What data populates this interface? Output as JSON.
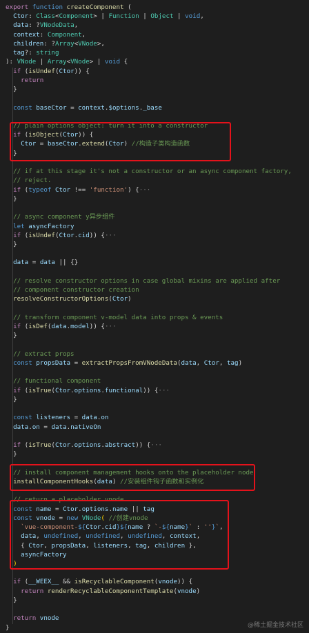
{
  "editor": {
    "title": "createComponent",
    "lines": [
      [
        [
          "c",
          "export "
        ],
        [
          "k",
          "function "
        ],
        [
          "f",
          "createComponent"
        ],
        [
          "n",
          " ("
        ]
      ],
      [
        [
          "v",
          "  Ctor"
        ],
        [
          "n",
          ": "
        ],
        [
          "ty",
          "Class"
        ],
        [
          "n",
          "<"
        ],
        [
          "ty",
          "Component"
        ],
        [
          "n",
          "> | "
        ],
        [
          "ty",
          "Function"
        ],
        [
          "n",
          " | "
        ],
        [
          "ty",
          "Object"
        ],
        [
          "n",
          " | "
        ],
        [
          "k",
          "void"
        ],
        [
          "n",
          ","
        ]
      ],
      [
        [
          "v",
          "  data"
        ],
        [
          "n",
          ": ?"
        ],
        [
          "ty",
          "VNodeData"
        ],
        [
          "n",
          ","
        ]
      ],
      [
        [
          "v",
          "  context"
        ],
        [
          "n",
          ": "
        ],
        [
          "ty",
          "Component"
        ],
        [
          "n",
          ","
        ]
      ],
      [
        [
          "v",
          "  children"
        ],
        [
          "n",
          ": ?"
        ],
        [
          "ty",
          "Array"
        ],
        [
          "n",
          "<"
        ],
        [
          "ty",
          "VNode"
        ],
        [
          "n",
          ">,"
        ]
      ],
      [
        [
          "v",
          "  tag"
        ],
        [
          "n",
          "?: "
        ],
        [
          "ty",
          "string"
        ]
      ],
      [
        [
          "n",
          "): "
        ],
        [
          "ty",
          "VNode"
        ],
        [
          "n",
          " | "
        ],
        [
          "ty",
          "Array"
        ],
        [
          "n",
          "<"
        ],
        [
          "ty",
          "VNode"
        ],
        [
          "n",
          "> | "
        ],
        [
          "k",
          "void"
        ],
        [
          "n",
          " {"
        ]
      ],
      [
        [
          "c",
          "  if "
        ],
        [
          "n",
          "("
        ],
        [
          "f",
          "isUndef"
        ],
        [
          "n",
          "("
        ],
        [
          "v",
          "Ctor"
        ],
        [
          "n",
          ")) {"
        ]
      ],
      [
        [
          "c",
          "    return"
        ]
      ],
      [
        [
          "n",
          "  }"
        ]
      ],
      [
        [
          "n",
          ""
        ]
      ],
      [
        [
          "k",
          "  const "
        ],
        [
          "v",
          "baseCtor"
        ],
        [
          "n",
          " = "
        ],
        [
          "v",
          "context"
        ],
        [
          "n",
          "."
        ],
        [
          "v",
          "$options"
        ],
        [
          "n",
          "."
        ],
        [
          "v",
          "_base"
        ]
      ],
      [
        [
          "n",
          ""
        ]
      ],
      [
        [
          "cm",
          "  // plain options object: turn it into a constructor"
        ]
      ],
      [
        [
          "c",
          "  if "
        ],
        [
          "n",
          "("
        ],
        [
          "f",
          "isObject"
        ],
        [
          "n",
          "("
        ],
        [
          "v",
          "Ctor"
        ],
        [
          "n",
          ")) {"
        ]
      ],
      [
        [
          "v",
          "    Ctor"
        ],
        [
          "n",
          " = "
        ],
        [
          "v",
          "baseCtor"
        ],
        [
          "n",
          "."
        ],
        [
          "f",
          "extend"
        ],
        [
          "n",
          "("
        ],
        [
          "v",
          "Ctor"
        ],
        [
          "n",
          ") "
        ],
        [
          "cm",
          "//构造子类构造函数"
        ]
      ],
      [
        [
          "n",
          "  }"
        ]
      ],
      [
        [
          "n",
          ""
        ]
      ],
      [
        [
          "cm",
          "  // if at this stage it's not a constructor or an async component factory,"
        ]
      ],
      [
        [
          "cm",
          "  // reject."
        ]
      ],
      [
        [
          "c",
          "  if "
        ],
        [
          "n",
          "("
        ],
        [
          "k",
          "typeof "
        ],
        [
          "v",
          "Ctor"
        ],
        [
          "n",
          " !== "
        ],
        [
          "s",
          "'function'"
        ],
        [
          "n",
          ") {"
        ],
        [
          "fold",
          "···"
        ]
      ],
      [
        [
          "n",
          "  }"
        ]
      ],
      [
        [
          "n",
          ""
        ]
      ],
      [
        [
          "cm",
          "  // async component y异步组件"
        ]
      ],
      [
        [
          "k",
          "  let "
        ],
        [
          "v",
          "asyncFactory"
        ]
      ],
      [
        [
          "c",
          "  if "
        ],
        [
          "n",
          "("
        ],
        [
          "f",
          "isUndef"
        ],
        [
          "n",
          "("
        ],
        [
          "v",
          "Ctor"
        ],
        [
          "n",
          "."
        ],
        [
          "v",
          "cid"
        ],
        [
          "n",
          ")) {"
        ],
        [
          "fold",
          "···"
        ]
      ],
      [
        [
          "n",
          "  }"
        ]
      ],
      [
        [
          "n",
          ""
        ]
      ],
      [
        [
          "v",
          "  data"
        ],
        [
          "n",
          " = "
        ],
        [
          "v",
          "data"
        ],
        [
          "n",
          " || {}"
        ]
      ],
      [
        [
          "n",
          ""
        ]
      ],
      [
        [
          "cm",
          "  // resolve constructor options in case global mixins are applied after"
        ]
      ],
      [
        [
          "cm",
          "  // component constructor creation"
        ]
      ],
      [
        [
          "f",
          "  resolveConstructorOptions"
        ],
        [
          "n",
          "("
        ],
        [
          "v",
          "Ctor"
        ],
        [
          "n",
          ")"
        ]
      ],
      [
        [
          "n",
          ""
        ]
      ],
      [
        [
          "cm",
          "  // transform component v-model data into props & events"
        ]
      ],
      [
        [
          "c",
          "  if "
        ],
        [
          "n",
          "("
        ],
        [
          "f",
          "isDef"
        ],
        [
          "n",
          "("
        ],
        [
          "v",
          "data"
        ],
        [
          "n",
          "."
        ],
        [
          "v",
          "model"
        ],
        [
          "n",
          ")) {"
        ],
        [
          "fold",
          "···"
        ]
      ],
      [
        [
          "n",
          "  }"
        ]
      ],
      [
        [
          "n",
          ""
        ]
      ],
      [
        [
          "cm",
          "  // extract props"
        ]
      ],
      [
        [
          "k",
          "  const "
        ],
        [
          "v",
          "propsData"
        ],
        [
          "n",
          " = "
        ],
        [
          "f",
          "extractPropsFromVNodeData"
        ],
        [
          "n",
          "("
        ],
        [
          "v",
          "data"
        ],
        [
          "n",
          ", "
        ],
        [
          "v",
          "Ctor"
        ],
        [
          "n",
          ", "
        ],
        [
          "v",
          "tag"
        ],
        [
          "n",
          ")"
        ]
      ],
      [
        [
          "n",
          ""
        ]
      ],
      [
        [
          "cm",
          "  // functional component"
        ]
      ],
      [
        [
          "c",
          "  if "
        ],
        [
          "n",
          "("
        ],
        [
          "f",
          "isTrue"
        ],
        [
          "n",
          "("
        ],
        [
          "v",
          "Ctor"
        ],
        [
          "n",
          "."
        ],
        [
          "v",
          "options"
        ],
        [
          "n",
          "."
        ],
        [
          "v",
          "functional"
        ],
        [
          "n",
          ")) {"
        ],
        [
          "fold",
          "···"
        ]
      ],
      [
        [
          "n",
          "  }"
        ]
      ],
      [
        [
          "n",
          ""
        ]
      ],
      [
        [
          "k",
          "  const "
        ],
        [
          "v",
          "listeners"
        ],
        [
          "n",
          " = "
        ],
        [
          "v",
          "data"
        ],
        [
          "n",
          "."
        ],
        [
          "v",
          "on"
        ]
      ],
      [
        [
          "v",
          "  data"
        ],
        [
          "n",
          "."
        ],
        [
          "v",
          "on"
        ],
        [
          "n",
          " = "
        ],
        [
          "v",
          "data"
        ],
        [
          "n",
          "."
        ],
        [
          "v",
          "nativeOn"
        ]
      ],
      [
        [
          "n",
          ""
        ]
      ],
      [
        [
          "c",
          "  if "
        ],
        [
          "n",
          "("
        ],
        [
          "f",
          "isTrue"
        ],
        [
          "n",
          "("
        ],
        [
          "v",
          "Ctor"
        ],
        [
          "n",
          "."
        ],
        [
          "v",
          "options"
        ],
        [
          "n",
          "."
        ],
        [
          "v",
          "abstract"
        ],
        [
          "n",
          ")) {"
        ],
        [
          "fold",
          "···"
        ]
      ],
      [
        [
          "n",
          "  }"
        ]
      ],
      [
        [
          "n",
          ""
        ]
      ],
      [
        [
          "cm",
          "  // install component management hooks onto the placeholder node"
        ]
      ],
      [
        [
          "f",
          "  installComponentHooks"
        ],
        [
          "n",
          "("
        ],
        [
          "v",
          "data"
        ],
        [
          "n",
          ") "
        ],
        [
          "cm",
          "//安装组件钩子函数和实例化"
        ]
      ],
      [
        [
          "n",
          ""
        ]
      ],
      [
        [
          "cm",
          "  // return a placeholder vnode"
        ]
      ],
      [
        [
          "k",
          "  const "
        ],
        [
          "v",
          "name"
        ],
        [
          "n",
          " = "
        ],
        [
          "v",
          "Ctor"
        ],
        [
          "n",
          "."
        ],
        [
          "v",
          "options"
        ],
        [
          "n",
          "."
        ],
        [
          "v",
          "name"
        ],
        [
          "n",
          " || "
        ],
        [
          "v",
          "tag"
        ]
      ],
      [
        [
          "k",
          "  const "
        ],
        [
          "v",
          "vnode"
        ],
        [
          "n",
          " = "
        ],
        [
          "k",
          "new "
        ],
        [
          "ty",
          "VNode"
        ],
        [
          "b",
          "("
        ],
        [
          "n",
          " "
        ],
        [
          "cm",
          "//创建vnode"
        ]
      ],
      [
        [
          "s",
          "    `vue-component-"
        ],
        [
          "k",
          "${"
        ],
        [
          "v",
          "Ctor"
        ],
        [
          "n",
          "."
        ],
        [
          "v",
          "cid"
        ],
        [
          "k",
          "}${"
        ],
        [
          "v",
          "name"
        ],
        [
          "n",
          " ? "
        ],
        [
          "s",
          "`-"
        ],
        [
          "k",
          "${"
        ],
        [
          "v",
          "name"
        ],
        [
          "k",
          "}"
        ],
        [
          "s",
          "`"
        ],
        [
          "n",
          " : "
        ],
        [
          "s",
          "''"
        ],
        [
          "k",
          "}"
        ],
        [
          "s",
          "`"
        ],
        [
          "n",
          ","
        ]
      ],
      [
        [
          "v",
          "    data"
        ],
        [
          "n",
          ", "
        ],
        [
          "k",
          "undefined"
        ],
        [
          "n",
          ", "
        ],
        [
          "k",
          "undefined"
        ],
        [
          "n",
          ", "
        ],
        [
          "k",
          "undefined"
        ],
        [
          "n",
          ", "
        ],
        [
          "v",
          "context"
        ],
        [
          "n",
          ","
        ]
      ],
      [
        [
          "n",
          "    { "
        ],
        [
          "v",
          "Ctor"
        ],
        [
          "n",
          ", "
        ],
        [
          "v",
          "propsData"
        ],
        [
          "n",
          ", "
        ],
        [
          "v",
          "listeners"
        ],
        [
          "n",
          ", "
        ],
        [
          "v",
          "tag"
        ],
        [
          "n",
          ", "
        ],
        [
          "v",
          "children"
        ],
        [
          "n",
          " },"
        ]
      ],
      [
        [
          "v",
          "    asyncFactory"
        ]
      ],
      [
        [
          "b",
          "  )"
        ]
      ],
      [
        [
          "n",
          ""
        ]
      ],
      [
        [
          "c",
          "  if "
        ],
        [
          "n",
          "("
        ],
        [
          "v",
          "__WEEX__"
        ],
        [
          "n",
          " && "
        ],
        [
          "f",
          "isRecyclableComponent"
        ],
        [
          "n",
          "("
        ],
        [
          "v",
          "vnode"
        ],
        [
          "n",
          ")) {"
        ]
      ],
      [
        [
          "c",
          "    return "
        ],
        [
          "f",
          "renderRecyclableComponentTemplate"
        ],
        [
          "n",
          "("
        ],
        [
          "v",
          "vnode"
        ],
        [
          "n",
          ")"
        ]
      ],
      [
        [
          "n",
          "  }"
        ]
      ],
      [
        [
          "n",
          ""
        ]
      ],
      [
        [
          "c",
          "  return "
        ],
        [
          "v",
          "vnode"
        ]
      ],
      [
        [
          "n",
          "}"
        ]
      ]
    ]
  },
  "watermark": "@稀土掘金技术社区"
}
